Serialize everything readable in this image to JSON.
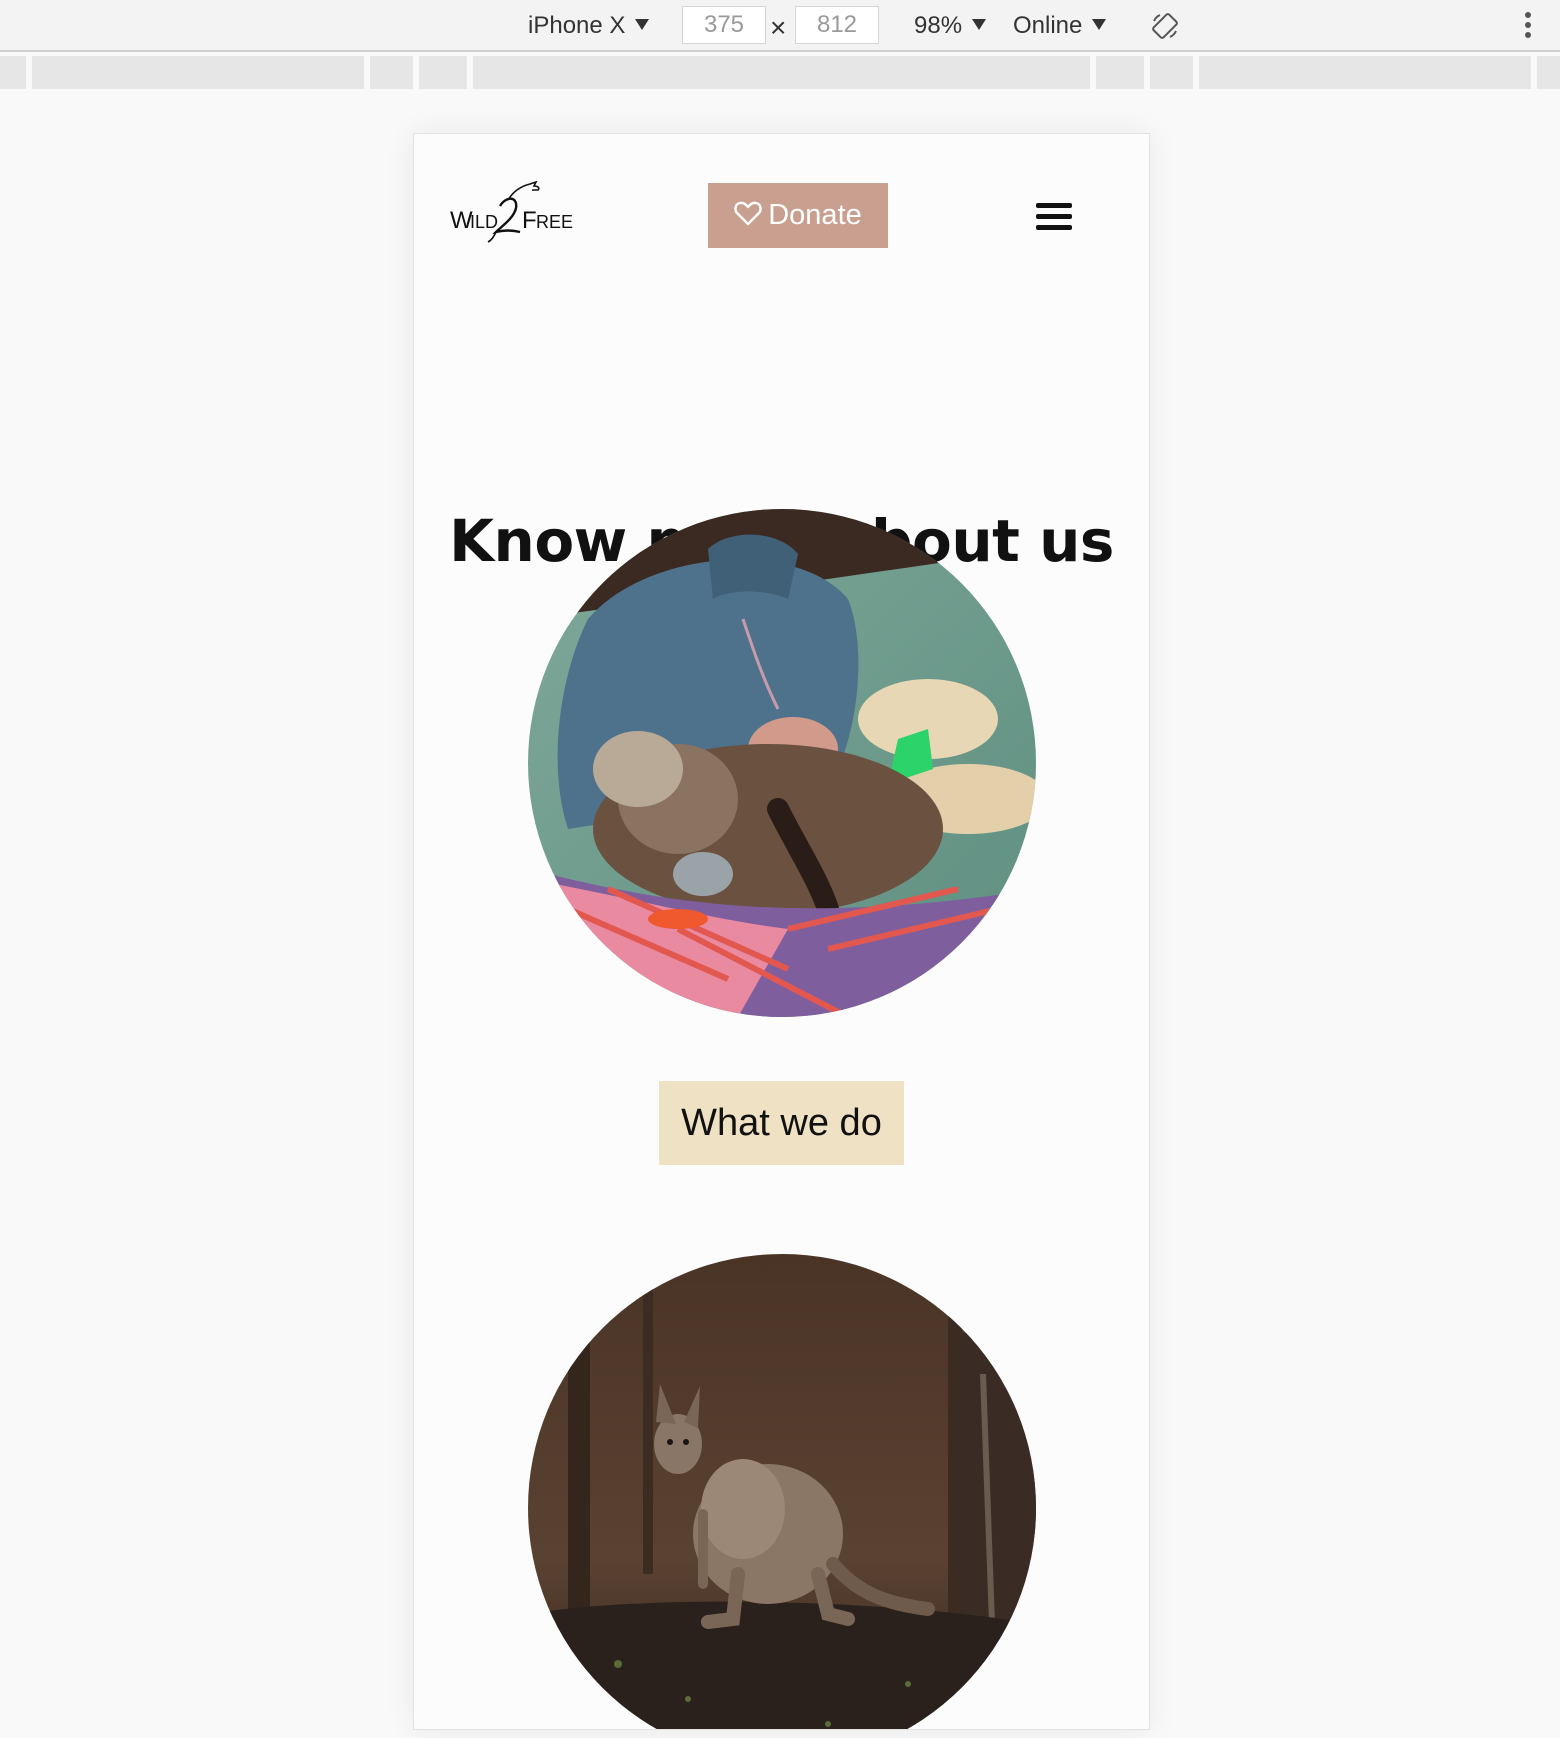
{
  "devtools": {
    "device_label": "iPhone X",
    "width_value": "375",
    "height_value": "812",
    "times_symbol": "×",
    "zoom_label": "98%",
    "network_label": "Online"
  },
  "site": {
    "logo_text": "WILD 2 FREE",
    "donate_label": "Donate",
    "heading": "Know more about us",
    "what_we_do_label": "What we do",
    "colors": {
      "donate_bg": "#c9a08f",
      "what_we_do_bg": "#efe2c4",
      "heading": "#111111"
    }
  }
}
